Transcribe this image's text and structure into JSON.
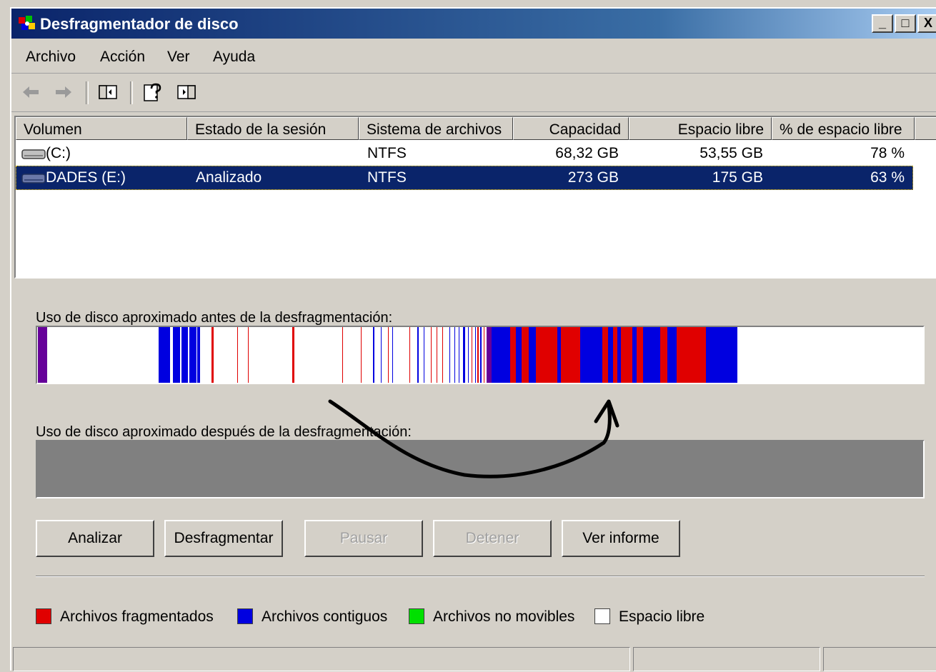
{
  "window": {
    "title": "Desfragmentador de disco",
    "controls": [
      "_",
      "□",
      "X"
    ]
  },
  "menu": [
    "Archivo",
    "Acción",
    "Ver",
    "Ayuda"
  ],
  "toolbar": {
    "icons": [
      "back-icon",
      "forward-icon",
      "show-hide-console-tree-icon",
      "help-icon",
      "show-hide-action-pane-icon"
    ]
  },
  "columns": [
    "Volumen",
    "Estado de la sesión",
    "Sistema de archivos",
    "Capacidad",
    "Espacio libre",
    "% de espacio libre"
  ],
  "volumes": [
    {
      "volume": "(C:)",
      "status": "",
      "filesystem": "NTFS",
      "capacity": "68,32 GB",
      "free": "53,55 GB",
      "percent": "78 %",
      "selected": false
    },
    {
      "volume": "DADES (E:)",
      "status": "Analizado",
      "filesystem": "NTFS",
      "capacity": "273 GB",
      "free": "175 GB",
      "percent": "63 %",
      "selected": true
    }
  ],
  "before_caption": "Uso de disco aproximado antes de la desfragmentación:",
  "after_caption": "Uso de disco aproximado después de la desfragmentación:",
  "buttons": [
    {
      "label": "Analizar",
      "enabled": true
    },
    {
      "label": "Desfragmentar",
      "enabled": true
    },
    {
      "label": "Pausar",
      "enabled": false
    },
    {
      "label": "Detener",
      "enabled": false
    },
    {
      "label": "Ver informe",
      "enabled": true
    }
  ],
  "legend": [
    {
      "label": "Archivos fragmentados",
      "color": "#e00000"
    },
    {
      "label": "Archivos contiguos",
      "color": "#0000e0"
    },
    {
      "label": "Archivos no movibles",
      "color": "#00e000"
    },
    {
      "label": "Espacio libre",
      "color": "#ffffff"
    }
  ],
  "colors": {
    "title_start": "#0a246a",
    "selection": "#0a246a",
    "fragmented": "#e00000",
    "contiguous": "#0000e0",
    "purple": "#660099",
    "after_bar": "#808080"
  },
  "disk_map_before": [
    {
      "color": "purple",
      "start": 0.001,
      "end": 0.011
    },
    {
      "color": "contiguous",
      "start": 0.137,
      "end": 0.15
    },
    {
      "color": "contiguous",
      "start": 0.153,
      "end": 0.161
    },
    {
      "color": "contiguous",
      "start": 0.163,
      "end": 0.17
    },
    {
      "color": "contiguous",
      "start": 0.172,
      "end": 0.18
    },
    {
      "color": "contiguous",
      "start": 0.181,
      "end": 0.184
    },
    {
      "color": "fragmented",
      "start": 0.197,
      "end": 0.199
    },
    {
      "color": "fragmented",
      "start": 0.226,
      "end": 0.227
    },
    {
      "color": "fragmented",
      "start": 0.238,
      "end": 0.239
    },
    {
      "color": "fragmented",
      "start": 0.288,
      "end": 0.29
    },
    {
      "color": "fragmented",
      "start": 0.344,
      "end": 0.345
    },
    {
      "color": "fragmented",
      "start": 0.365,
      "end": 0.366
    },
    {
      "color": "contiguous",
      "start": 0.379,
      "end": 0.381
    },
    {
      "color": "contiguous",
      "start": 0.388,
      "end": 0.389
    },
    {
      "color": "fragmented",
      "start": 0.396,
      "end": 0.397
    },
    {
      "color": "contiguous",
      "start": 0.401,
      "end": 0.402
    },
    {
      "color": "fragmented",
      "start": 0.42,
      "end": 0.421
    },
    {
      "color": "contiguous",
      "start": 0.429,
      "end": 0.431
    },
    {
      "color": "contiguous",
      "start": 0.436,
      "end": 0.437
    },
    {
      "color": "fragmented",
      "start": 0.444,
      "end": 0.445
    },
    {
      "color": "fragmented",
      "start": 0.451,
      "end": 0.452
    },
    {
      "color": "fragmented",
      "start": 0.457,
      "end": 0.458
    },
    {
      "color": "contiguous",
      "start": 0.465,
      "end": 0.466
    },
    {
      "color": "contiguous",
      "start": 0.471,
      "end": 0.472
    },
    {
      "color": "contiguous",
      "start": 0.476,
      "end": 0.477
    },
    {
      "color": "contiguous",
      "start": 0.481,
      "end": 0.483
    },
    {
      "color": "contiguous",
      "start": 0.486,
      "end": 0.487
    },
    {
      "color": "fragmented",
      "start": 0.49,
      "end": 0.491
    },
    {
      "color": "contiguous",
      "start": 0.494,
      "end": 0.495
    },
    {
      "color": "fragmented",
      "start": 0.497,
      "end": 0.498
    },
    {
      "color": "contiguous",
      "start": 0.5,
      "end": 0.502
    },
    {
      "color": "fragmented",
      "start": 0.504,
      "end": 0.505
    },
    {
      "color": "purple",
      "start": 0.507,
      "end": 0.513
    },
    {
      "color": "contiguous",
      "start": 0.513,
      "end": 0.534
    },
    {
      "color": "fragmented",
      "start": 0.534,
      "end": 0.54
    },
    {
      "color": "contiguous",
      "start": 0.54,
      "end": 0.547
    },
    {
      "color": "fragmented",
      "start": 0.547,
      "end": 0.555
    },
    {
      "color": "contiguous",
      "start": 0.555,
      "end": 0.563
    },
    {
      "color": "fragmented",
      "start": 0.563,
      "end": 0.587
    },
    {
      "color": "contiguous",
      "start": 0.587,
      "end": 0.591
    },
    {
      "color": "fragmented",
      "start": 0.591,
      "end": 0.613
    },
    {
      "color": "contiguous",
      "start": 0.613,
      "end": 0.638
    },
    {
      "color": "fragmented",
      "start": 0.638,
      "end": 0.644
    },
    {
      "color": "contiguous",
      "start": 0.644,
      "end": 0.65
    },
    {
      "color": "fragmented",
      "start": 0.65,
      "end": 0.655
    },
    {
      "color": "contiguous",
      "start": 0.655,
      "end": 0.659
    },
    {
      "color": "fragmented",
      "start": 0.659,
      "end": 0.672
    },
    {
      "color": "contiguous",
      "start": 0.672,
      "end": 0.677
    },
    {
      "color": "fragmented",
      "start": 0.677,
      "end": 0.684
    },
    {
      "color": "contiguous",
      "start": 0.684,
      "end": 0.703
    },
    {
      "color": "fragmented",
      "start": 0.703,
      "end": 0.711
    },
    {
      "color": "contiguous",
      "start": 0.711,
      "end": 0.722
    },
    {
      "color": "fragmented",
      "start": 0.722,
      "end": 0.755
    },
    {
      "color": "contiguous",
      "start": 0.755,
      "end": 0.79
    }
  ]
}
